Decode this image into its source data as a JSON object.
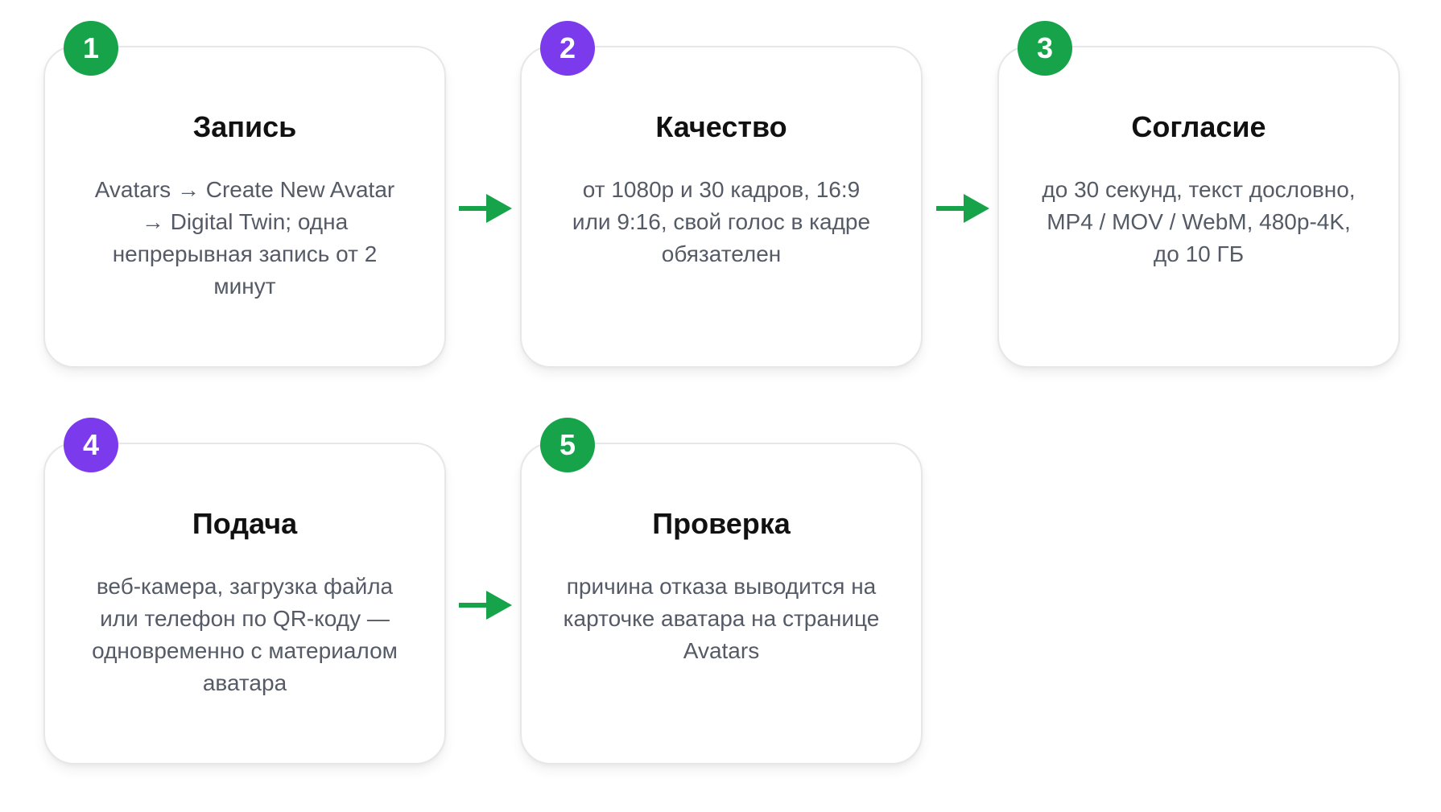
{
  "colors": {
    "green": "#16a34a",
    "purple": "#7c3aed",
    "arrow": "#16a34a",
    "title": "#111111",
    "text": "#555b66",
    "border": "#e6e7ea"
  },
  "steps": [
    {
      "number": "1",
      "badge_color": "green",
      "title": "Запись",
      "description": "Avatars → Create New Avatar → Digital Twin; одна непрерывная запись от 2 минут"
    },
    {
      "number": "2",
      "badge_color": "purple",
      "title": "Качество",
      "description": "от 1080p и 30 кадров, 16:9 или 9:16, свой голос в кадре обязателен"
    },
    {
      "number": "3",
      "badge_color": "green",
      "title": "Согласие",
      "description": "до 30 секунд, текст дословно, MP4 / MOV / WebM, 480p-4K, до 10 ГБ"
    },
    {
      "number": "4",
      "badge_color": "purple",
      "title": "Подача",
      "description": "веб-камера, загрузка файла или телефон по QR-коду — одновременно с материалом аватара"
    },
    {
      "number": "5",
      "badge_color": "green",
      "title": "Проверка",
      "description": "причина отказа выводится на карточке аватара на странице Avatars"
    }
  ],
  "arrows": [
    {
      "from": "1",
      "to": "2",
      "icon": "arrow-right-icon"
    },
    {
      "from": "2",
      "to": "3",
      "icon": "arrow-right-icon"
    },
    {
      "from": "4",
      "to": "5",
      "icon": "arrow-right-icon"
    }
  ]
}
